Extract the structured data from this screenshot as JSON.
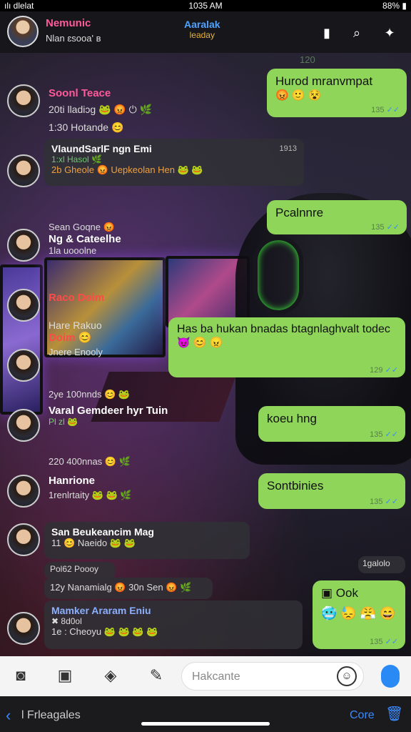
{
  "status_bar": {
    "carrier": "ılı dlelat",
    "time": "1035 AM",
    "battery": "88%"
  },
  "header": {
    "name": "Nemunic",
    "subtitle": "Nlan ɛsooa' ʙ",
    "center_title": "Aaralak",
    "center_sub": "leaday",
    "icons": [
      "sim-card-icon",
      "search-icon",
      "magic-icon"
    ]
  },
  "messages": [
    {
      "side": "out",
      "text": "Hurod mranvmpat",
      "emojis": "😡 🙂 😵",
      "time": "135",
      "top_time": "120"
    },
    {
      "side": "in",
      "name": "Soonl Teace",
      "name_color": "#ff5a9a",
      "line": "20ti lladiɔg 🐸 😡 ⏻ 🌿",
      "line2": "1:30 Hotande 😊"
    },
    {
      "side": "in",
      "name": "VlaundSarlF ngn Emi",
      "name_color": "#fff",
      "line": "1:xl Hasol 🌿",
      "line2": "2b Gheole 😡 Uepkeolan Hen 🐸 🐸",
      "time": "1913"
    },
    {
      "side": "out",
      "text": "Pcalnnre",
      "time": "135"
    },
    {
      "side": "in",
      "name": "Ng & Cateelhe",
      "name_color": "#fff",
      "pre": "Sean Goqne 😡",
      "line": "1la uooolne"
    },
    {
      "side": "in",
      "name": "Raco Doim",
      "name_color": "#ff4a4a",
      "line": "Hare Rakuo",
      "line2": "Doim 😊",
      "line3": "Jnere Enooly"
    },
    {
      "side": "out",
      "text": "Has ba hukan bnadas btagnlaghvalt todec",
      "emojis": "😈 😊 😠",
      "time": "129"
    },
    {
      "side": "in",
      "name": "Varal Gemdeer hyr Tuin",
      "name_color": "#fff",
      "pre": "2ye 100nnds 😊 🐸",
      "line": "Pl zl 🐸"
    },
    {
      "side": "out",
      "text": "koeu hng",
      "time": "135"
    },
    {
      "side": "in",
      "name": "Hanrione",
      "name_color": "#fff",
      "pre": "220 400nnas 😊 🌿",
      "line": "1renlrtaity 🐸 🐸 🌿"
    },
    {
      "side": "out",
      "text": "Sontbinies",
      "time": "135"
    },
    {
      "side": "in",
      "name": "San Beukeancim Mag",
      "name_color": "#fff",
      "line": "11 😊 Naeido 🐸 🐸"
    },
    {
      "side": "in",
      "name": "",
      "line": "Pol62 Poooy",
      "time": "1galolo"
    },
    {
      "side": "in",
      "name": "",
      "line": "12y Nanamialg 😡 30n Sen 😡 🌿"
    },
    {
      "side": "out",
      "text": "Ook",
      "emojis": "🥶 😓 😤 😄",
      "time": "135"
    },
    {
      "side": "in",
      "name": "Mamker Araram Eniu",
      "name_color": "#8ab0ff",
      "line": "✖ 8d0ol",
      "line2": "1e : Cheoyu 🐸 🐸 🐸 🐸"
    }
  ],
  "composer": {
    "placeholder": "Hakcante",
    "icons": [
      "camera-icon",
      "gallery-icon",
      "sticker-icon",
      "attach-icon"
    ]
  },
  "bottom_bar": {
    "back_label": "l Frleagales",
    "done_label": "Core"
  },
  "colors": {
    "green_bubble": "#8ed55a",
    "dark_bubble": "#303036",
    "accent": "#3a8aff"
  }
}
